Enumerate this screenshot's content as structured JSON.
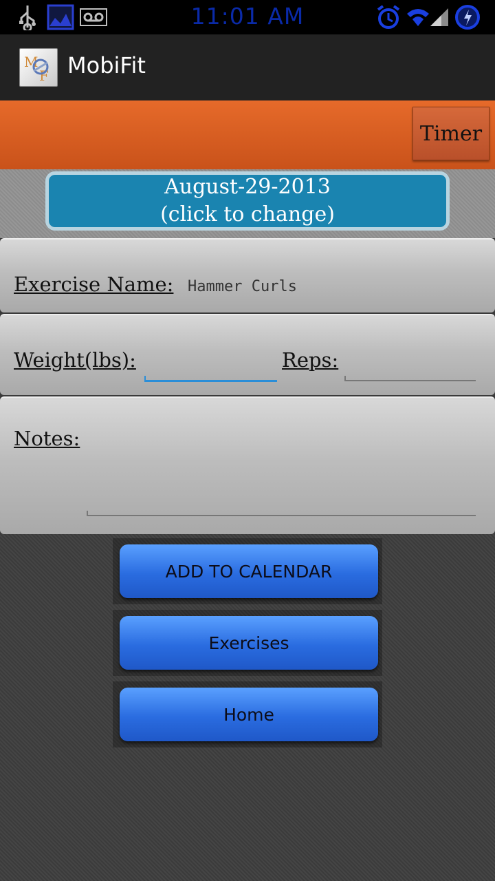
{
  "status_bar": {
    "time": "11:01 AM",
    "icons": [
      "usb-icon",
      "gallery-icon",
      "voicemail-icon",
      "alarm-icon",
      "wifi-icon",
      "signal-icon",
      "battery-icon"
    ]
  },
  "app": {
    "title": "MobiFit",
    "icon": "mobifit-logo"
  },
  "toolbar": {
    "timer_label": "Timer"
  },
  "date_button": {
    "date": "August-29-2013",
    "hint": "(click to change)"
  },
  "form": {
    "exercise_name_label": "Exercise Name:",
    "exercise_name_value": "Hammer Curls",
    "weight_label": "Weight(lbs):",
    "weight_value": "",
    "reps_label": "Reps:",
    "reps_value": "",
    "notes_label": "Notes:",
    "notes_value": ""
  },
  "buttons": {
    "add_to_calendar": "ADD TO CALENDAR",
    "exercises": "Exercises",
    "home": "Home"
  },
  "colors": {
    "accent_orange": "#e0622a",
    "date_button_blue": "#1a84b0",
    "action_button_blue": "#2a6ce0",
    "status_time_blue": "#0a2aa8"
  }
}
